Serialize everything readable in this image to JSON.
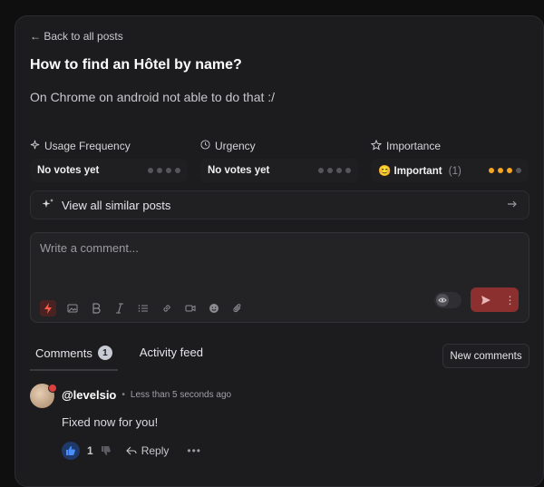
{
  "back_link": "← Back to all posts",
  "post": {
    "title": "How to find an Hôtel by name?",
    "body": "On Chrome on android not able to do that :/"
  },
  "metrics": [
    {
      "label": "Usage Frequency",
      "icon": "sparkle-icon",
      "value": "No votes yet",
      "level": 0
    },
    {
      "label": "Urgency",
      "icon": "clock-icon",
      "value": "No votes yet",
      "level": 0
    },
    {
      "label": "Importance",
      "icon": "star-icon",
      "value": "Important",
      "emoji": "😊",
      "count": "(1)",
      "level": 3
    }
  ],
  "similar_button": "View all similar posts",
  "composer": {
    "placeholder": "Write a comment...",
    "tools": [
      "bolt-icon",
      "image-icon",
      "bold-icon",
      "italic-icon",
      "list-icon",
      "link-icon",
      "video-icon",
      "emoji-icon",
      "attachment-icon"
    ]
  },
  "tabs": {
    "comments": "Comments",
    "comments_count": "1",
    "activity": "Activity feed"
  },
  "new_comments_button": "New comments",
  "comment": {
    "author": "@levelsio",
    "separator": "•",
    "time": "Less than 5 seconds ago",
    "text": "Fixed now for you!",
    "likes": "1",
    "reply_label": "Reply",
    "more": "•••"
  },
  "colors": {
    "accent_red": "#8b2f2f",
    "rating_orange": "#f5a623",
    "like_blue": "#4a8ff7"
  }
}
